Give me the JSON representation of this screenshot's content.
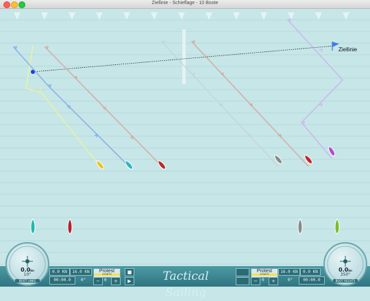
{
  "window": {
    "title": "Ziellinie - Schieflage - 10 Boote"
  },
  "course": {
    "finish_label": "Ziellinie"
  },
  "boats": [
    {
      "id": "yellow",
      "color": "#e8c62a"
    },
    {
      "id": "cyan",
      "color": "#2bb6c0"
    },
    {
      "id": "red",
      "color": "#c0262a"
    },
    {
      "id": "grey",
      "color": "#8a8a8a"
    },
    {
      "id": "red2",
      "color": "#c0262a"
    },
    {
      "id": "purple",
      "color": "#b04bd0"
    }
  ],
  "start_boats": [
    {
      "id": "teal",
      "color": "#1fb8b0"
    },
    {
      "id": "crimson",
      "color": "#b3232a"
    },
    {
      "id": "slate",
      "color": "#8a8a8a"
    },
    {
      "id": "lime",
      "color": "#7cba2a"
    }
  ],
  "panel": {
    "left": {
      "speed1": "0.0 KN",
      "speed2": "16.0 KN",
      "protest": "Protest",
      "protest_status": "STARTS",
      "time": "00:00.0",
      "heel": "0°",
      "minus": "−",
      "counter": "0",
      "plus": "+"
    },
    "right": {
      "speed1": "16.0 KN",
      "speed2": "0.0 KN",
      "protest": "Protest",
      "protest_status": "STARTS",
      "time": "00:00.0",
      "heel": "0°",
      "minus": "−",
      "counter": "0",
      "plus": "+"
    },
    "stop_label": "■",
    "play_label": "▶",
    "brand": "Tactical Sailing"
  },
  "gauges": {
    "left": {
      "speed": "0.0",
      "unit": "kn",
      "heading": "10°",
      "name": "BOOT LINKS"
    },
    "right": {
      "speed": "0.0",
      "unit": "kn",
      "heading": "350°",
      "name": "BOOT RECHTS"
    }
  }
}
